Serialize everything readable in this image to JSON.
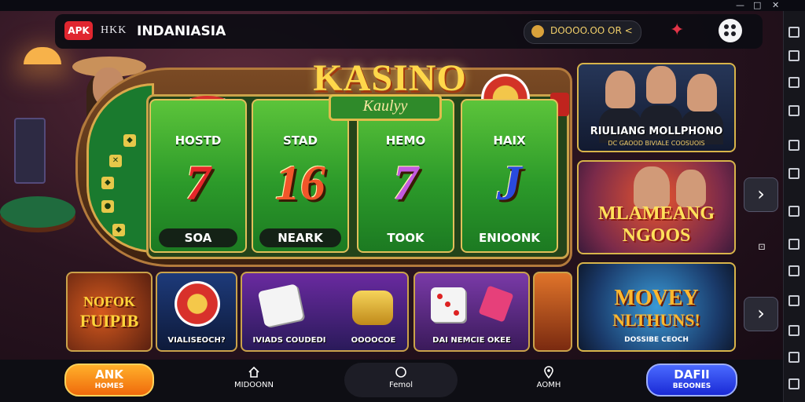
{
  "topbar": {
    "badge": "APK",
    "brand_prefix": "HKK",
    "brand": "INDANIASIA",
    "coins": "DOOOO.OO OR <"
  },
  "machine": {
    "title": "KASINO",
    "subtitle": "Kaulyy",
    "reels": [
      {
        "label": "HOSTD",
        "symbol": "7",
        "button": "SOA",
        "symbol_color": "#e5262a"
      },
      {
        "label": "STAD",
        "symbol": "16",
        "button": "NEARK",
        "symbol_color": "#f2562a"
      },
      {
        "label": "HEMO",
        "symbol": "7",
        "button": "TOOK",
        "symbol_color": "#c35ae0"
      },
      {
        "label": "HAIX",
        "symbol": "J",
        "button": "ENIOONK",
        "symbol_color": "#2a4adf"
      }
    ]
  },
  "promos": [
    {
      "title": "RIULIANG MOLLPHONO",
      "subtitle": "DC GAOOD BIVIALE COOSUOIS"
    },
    {
      "title_line1": "MLAMEANG",
      "title_line2": "NGOOS"
    },
    {
      "title_line1": "MOVEY",
      "title_line2": "NLTHUNS!",
      "subtitle": "DOSSIBE CEOCH"
    }
  ],
  "cards": [
    {
      "title_line1": "NOFOK",
      "title_line2": "FUIPIB"
    },
    {
      "label": "VIALISEOCH?"
    },
    {
      "label": "IVIADS COUDEDI"
    },
    {
      "label": "OOOOCOE"
    },
    {
      "label": "DAI NEMCIE OKEE"
    }
  ],
  "bottom_nav": {
    "left_main": "ANK",
    "left_sub": "HOMES",
    "item1": "MIDOONN",
    "item2": "Femol",
    "item3": "AOMH",
    "right_main": "DAFII",
    "right_sub": "BEOONES"
  },
  "colors": {
    "accent_gold": "#ffd84a",
    "reel_green": "#2c9a2a",
    "brand_red": "#e0262f",
    "nav_orange": "#f06a0c",
    "nav_blue": "#1a2ad6"
  },
  "icons": {
    "coin": "coin-icon",
    "favorite": "star-badge-icon",
    "menu": "grid-menu-icon",
    "next": "chevron-right-icon"
  }
}
